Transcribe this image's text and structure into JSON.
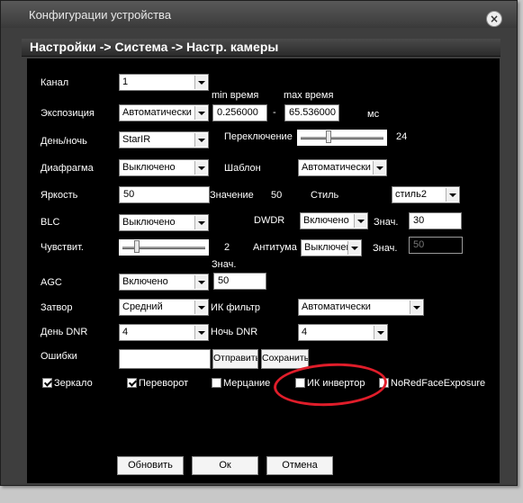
{
  "window": {
    "title": "Конфигурации устройства",
    "close": "×"
  },
  "breadcrumb": "Настройки -> Система -> Настр. камеры",
  "form": {
    "channel": {
      "label": "Канал",
      "value": "1"
    },
    "exposure": {
      "label": "Экспозиция",
      "value": "Автоматически",
      "min_label": "min время",
      "max_label": "max время",
      "min_value": "0.256000",
      "dash": "-",
      "max_value": "65.536000",
      "unit": "мс"
    },
    "daynight": {
      "label": "День/ночь",
      "value": "StarIR",
      "switch_label": "Переключение",
      "switch_value": 24,
      "switch_display": "24",
      "switch_fraction": 0.33
    },
    "iris": {
      "label": "Диафрагма",
      "value": "Выключено",
      "template_label": "Шаблон",
      "template_value": "Автоматически"
    },
    "brightness": {
      "label": "Яркость",
      "value": "50",
      "value_label": "Значение",
      "value_display": "50",
      "style_label": "Стиль",
      "style_value": "стиль2"
    },
    "blc": {
      "label": "BLC",
      "value": "Выключено",
      "dwdr_label": "DWDR",
      "dwdr_value": "Включено",
      "znach_label": "Знач.",
      "znach_value": "30"
    },
    "sensitivity": {
      "label": "Чувствит.",
      "slider_fraction": 0.15,
      "value_display": "2",
      "antituman_label": "Антитума",
      "antituman_value": "Выключено",
      "znach_label": "Знач.",
      "znach_value": "50"
    },
    "agc": {
      "label": "AGC",
      "value_label": "Знач.",
      "value": "Включено",
      "znach_value": "50"
    },
    "shutter": {
      "label": "Затвор",
      "value": "Средний",
      "ir_filter_label": "ИК фильтр",
      "ir_filter_value": "Автоматически"
    },
    "day_dnr": {
      "label": "День DNR",
      "value": "4",
      "night_label": "Ночь DNR",
      "night_value": "4"
    },
    "errors": {
      "label": "Ошибки",
      "value": "",
      "send_button": "Отправить",
      "save_button": "Сохранить"
    },
    "checkboxes": {
      "mirror": {
        "label": "Зеркало",
        "checked": true
      },
      "flip": {
        "label": "Переворот",
        "checked": true
      },
      "flicker": {
        "label": "Мерцание",
        "checked": false
      },
      "ir_invert": {
        "label": "ИК инвертор",
        "checked": false
      },
      "noredface": {
        "label": "NoRedFaceExposure",
        "checked": false
      }
    }
  },
  "buttons": {
    "refresh": "Обновить",
    "ok": "Ок",
    "cancel": "Отмена"
  },
  "colors": {
    "window_bg": "#3e3e3e",
    "panel_bg": "#000000",
    "annotation": "#e01d2a",
    "page_bg": "#c8c8c8"
  }
}
